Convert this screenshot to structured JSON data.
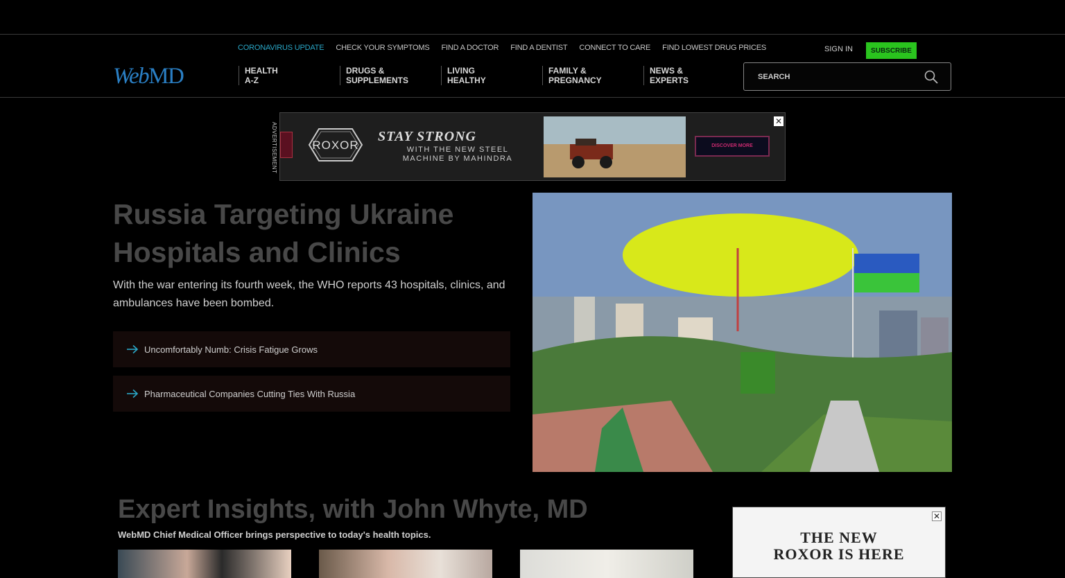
{
  "utility_nav": {
    "items": [
      {
        "label": "CORONAVIRUS UPDATE",
        "highlight": true
      },
      {
        "label": "CHECK YOUR SYMPTOMS"
      },
      {
        "label": "FIND A DOCTOR"
      },
      {
        "label": "FIND A DENTIST"
      },
      {
        "label": "CONNECT TO CARE"
      },
      {
        "label": "FIND LOWEST DRUG PRICES"
      }
    ],
    "sign_in": "SIGN IN",
    "subscribe": "SUBSCRIBE"
  },
  "logo": {
    "web": "Web",
    "md": "MD"
  },
  "main_nav": [
    {
      "line1": "HEALTH",
      "line2": "A-Z"
    },
    {
      "line1": "DRUGS &",
      "line2": "SUPPLEMENTS"
    },
    {
      "line1": "LIVING",
      "line2": "HEALTHY"
    },
    {
      "line1": "FAMILY &",
      "line2": "PREGNANCY"
    },
    {
      "line1": "NEWS &",
      "line2": "EXPERTS"
    }
  ],
  "search": {
    "placeholder": "SEARCH"
  },
  "ad_banner": {
    "label": "ADVERTISEMENT",
    "brand": "ROXOR",
    "headline": "STAY STRONG",
    "sub_line1": "WITH THE NEW STEEL",
    "sub_line2": "MACHINE BY MAHINDRA",
    "cta": "DISCOVER MORE",
    "close": "✕"
  },
  "hero": {
    "title": "Russia Targeting Ukraine Hospitals and Clinics",
    "dek": "With the war entering its fourth week, the WHO reports 43 hospitals, clinics, and ambulances have been bombed.",
    "related": [
      {
        "label": "Uncomfortably Numb: Crisis Fatigue Grows"
      },
      {
        "label": "Pharmaceutical Companies Cutting Ties With Russia"
      }
    ]
  },
  "expert_section": {
    "title": "Expert Insights, with John Whyte, MD",
    "subtitle": "WebMD Chief Medical Officer brings perspective to today's health topics."
  },
  "side_ad": {
    "headline_line1": "THE NEW",
    "headline_line2": "ROXOR IS HERE",
    "close": "✕"
  },
  "colors": {
    "accent": "#2aa8c8",
    "subscribe": "#2ac41e",
    "logo": "#2a7fc4"
  }
}
